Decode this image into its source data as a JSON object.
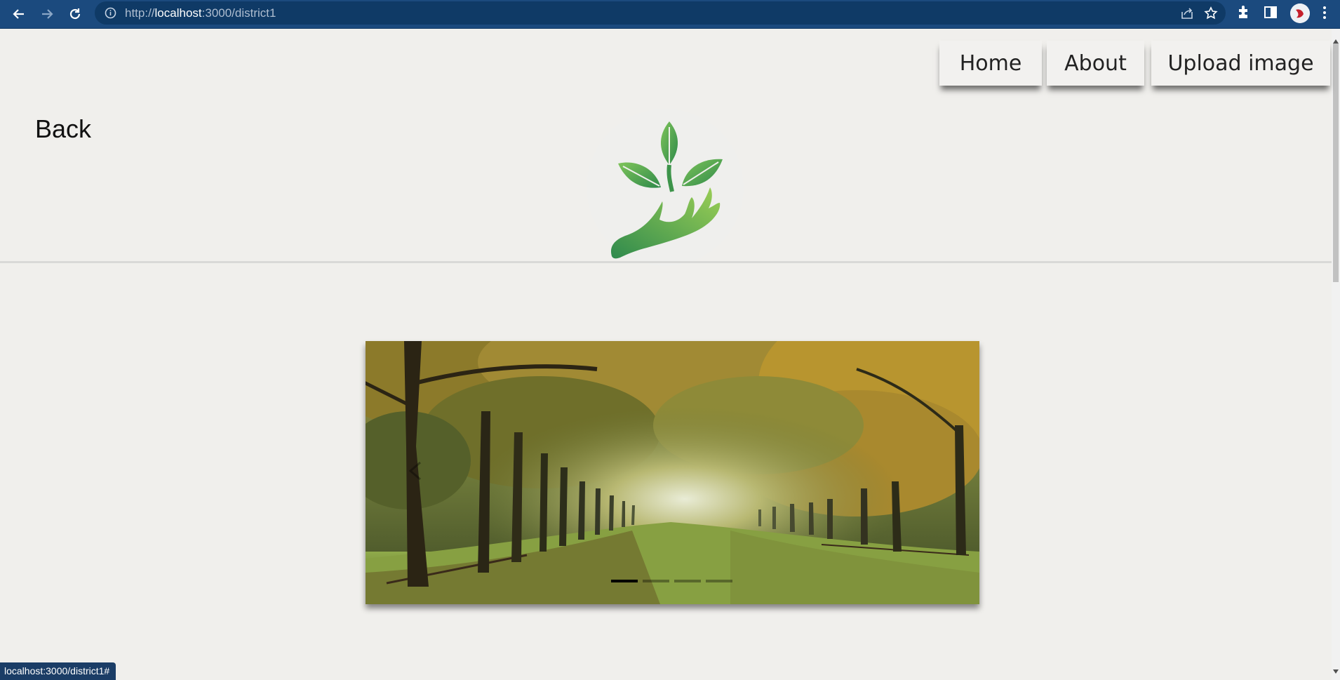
{
  "browser": {
    "url_prefix": "http://",
    "url_host": "localhost",
    "url_path": ":3000/district1",
    "status_url": "localhost:3000/district1#"
  },
  "nav": {
    "items": [
      {
        "label": "Home"
      },
      {
        "label": "About"
      },
      {
        "label": "Upload image"
      }
    ]
  },
  "page": {
    "back_label": "Back",
    "logo_icon": "plant-in-hand-logo",
    "carousel": {
      "image": "autumn-tree-avenue",
      "indicator_count": 4,
      "active_index": 0
    }
  },
  "colors": {
    "chrome": "#1b4a7e",
    "background": "#f0efec",
    "leaf_green": "#4fa64a"
  }
}
